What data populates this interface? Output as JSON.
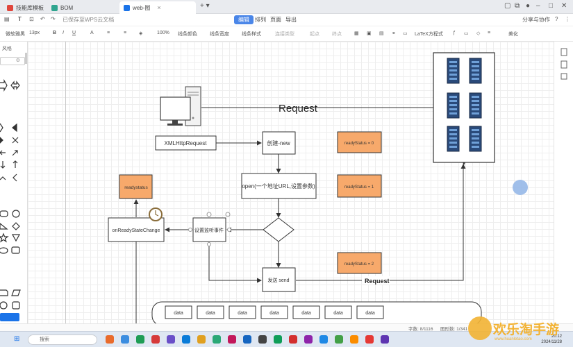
{
  "tabs": [
    {
      "label": "技能库模板",
      "color": "#e0463c"
    },
    {
      "label": "BOM",
      "color": "#2fa58f"
    },
    {
      "label": "web-图",
      "color": "#1a73e8"
    }
  ],
  "menubar": {
    "saved_text": "已保存至WPS云文档",
    "tabs": [
      "编辑",
      "排列",
      "页面",
      "导出"
    ],
    "share_label": "分享与协作"
  },
  "toolbar": {
    "font_family": "微软雅黑",
    "font_size": "13px",
    "zoom": "100%",
    "line_color": "线条颜色",
    "line_width": "线条宽度",
    "line_style": "线条样式",
    "connector_type": "连接类型",
    "start": "起点",
    "end": "终点",
    "latex": "LaTeX方程式",
    "beautify": "美化"
  },
  "leftpanel": {
    "title": "风格"
  },
  "diagram": {
    "request_top": "Request",
    "request_bottom": "Request",
    "xhr": "XMLHttpRequest",
    "create_new": "创建-new",
    "open": "open(一个地址URL,设置参数)",
    "set_listener": "设置监听事件",
    "send": "发送 send",
    "ready_status": "readystatus",
    "on_ready": "onReadyStateChange",
    "rs0": "readyStatus = 0",
    "rs1": "readyStatus = 1",
    "rs2": "readyStatus = 2",
    "data_items": [
      "data",
      "data",
      "data",
      "data",
      "data",
      "data",
      "data"
    ]
  },
  "colors": {
    "accent": "#4a86e8",
    "orange_box": "#f7a96b",
    "server_blue": "#2a4a7a"
  },
  "statusbar": {
    "chars": "字数: 8/1116",
    "shapes": "图形数: 1/341"
  },
  "taskbar": {
    "search": "搜索",
    "time": "20:12",
    "date": "2024/11/28"
  },
  "watermark": {
    "text": "欢乐淘手游",
    "url": "www.huanletao.com"
  }
}
